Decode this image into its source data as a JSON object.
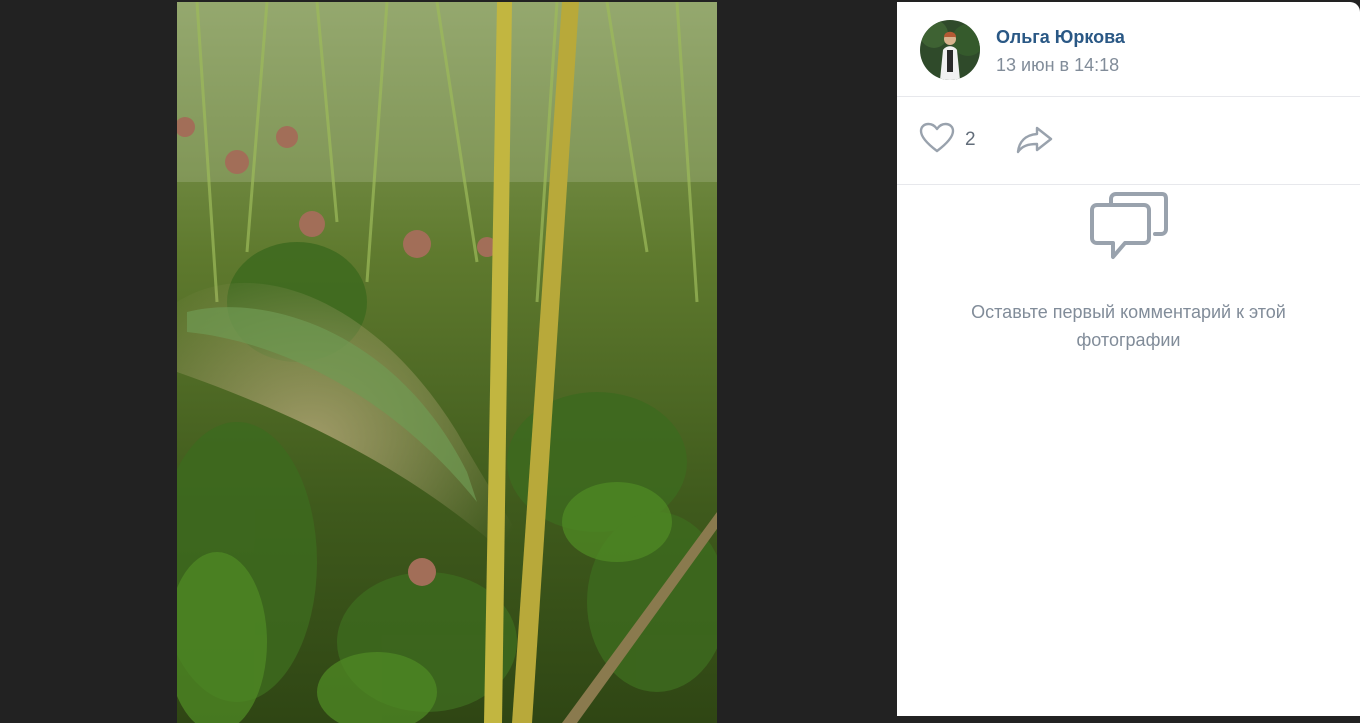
{
  "post": {
    "author_name": "Ольга Юркова",
    "date": "13 июн в 14:18"
  },
  "actions": {
    "likes_count": "2",
    "like_icon": "heart-outline-icon",
    "share_icon": "share-arrow-icon"
  },
  "comments": {
    "empty_icon": "comment-bubbles-icon",
    "empty_text": "Оставьте первый комментарий к этой фотографии"
  },
  "colors": {
    "accent": "#2a5885",
    "muted": "#818c99",
    "icon": "#99a2ad",
    "background": "#222222"
  }
}
